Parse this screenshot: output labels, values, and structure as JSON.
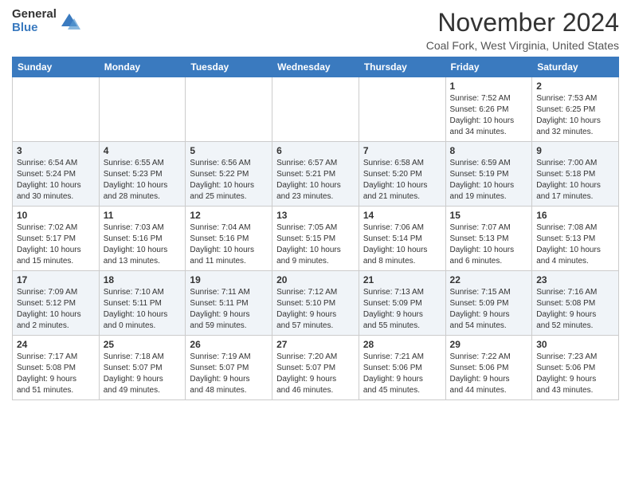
{
  "logo": {
    "general": "General",
    "blue": "Blue"
  },
  "header": {
    "month": "November 2024",
    "location": "Coal Fork, West Virginia, United States"
  },
  "weekdays": [
    "Sunday",
    "Monday",
    "Tuesday",
    "Wednesday",
    "Thursday",
    "Friday",
    "Saturday"
  ],
  "weeks": [
    [
      {
        "day": "",
        "info": ""
      },
      {
        "day": "",
        "info": ""
      },
      {
        "day": "",
        "info": ""
      },
      {
        "day": "",
        "info": ""
      },
      {
        "day": "",
        "info": ""
      },
      {
        "day": "1",
        "info": "Sunrise: 7:52 AM\nSunset: 6:26 PM\nDaylight: 10 hours\nand 34 minutes."
      },
      {
        "day": "2",
        "info": "Sunrise: 7:53 AM\nSunset: 6:25 PM\nDaylight: 10 hours\nand 32 minutes."
      }
    ],
    [
      {
        "day": "3",
        "info": "Sunrise: 6:54 AM\nSunset: 5:24 PM\nDaylight: 10 hours\nand 30 minutes."
      },
      {
        "day": "4",
        "info": "Sunrise: 6:55 AM\nSunset: 5:23 PM\nDaylight: 10 hours\nand 28 minutes."
      },
      {
        "day": "5",
        "info": "Sunrise: 6:56 AM\nSunset: 5:22 PM\nDaylight: 10 hours\nand 25 minutes."
      },
      {
        "day": "6",
        "info": "Sunrise: 6:57 AM\nSunset: 5:21 PM\nDaylight: 10 hours\nand 23 minutes."
      },
      {
        "day": "7",
        "info": "Sunrise: 6:58 AM\nSunset: 5:20 PM\nDaylight: 10 hours\nand 21 minutes."
      },
      {
        "day": "8",
        "info": "Sunrise: 6:59 AM\nSunset: 5:19 PM\nDaylight: 10 hours\nand 19 minutes."
      },
      {
        "day": "9",
        "info": "Sunrise: 7:00 AM\nSunset: 5:18 PM\nDaylight: 10 hours\nand 17 minutes."
      }
    ],
    [
      {
        "day": "10",
        "info": "Sunrise: 7:02 AM\nSunset: 5:17 PM\nDaylight: 10 hours\nand 15 minutes."
      },
      {
        "day": "11",
        "info": "Sunrise: 7:03 AM\nSunset: 5:16 PM\nDaylight: 10 hours\nand 13 minutes."
      },
      {
        "day": "12",
        "info": "Sunrise: 7:04 AM\nSunset: 5:16 PM\nDaylight: 10 hours\nand 11 minutes."
      },
      {
        "day": "13",
        "info": "Sunrise: 7:05 AM\nSunset: 5:15 PM\nDaylight: 10 hours\nand 9 minutes."
      },
      {
        "day": "14",
        "info": "Sunrise: 7:06 AM\nSunset: 5:14 PM\nDaylight: 10 hours\nand 8 minutes."
      },
      {
        "day": "15",
        "info": "Sunrise: 7:07 AM\nSunset: 5:13 PM\nDaylight: 10 hours\nand 6 minutes."
      },
      {
        "day": "16",
        "info": "Sunrise: 7:08 AM\nSunset: 5:13 PM\nDaylight: 10 hours\nand 4 minutes."
      }
    ],
    [
      {
        "day": "17",
        "info": "Sunrise: 7:09 AM\nSunset: 5:12 PM\nDaylight: 10 hours\nand 2 minutes."
      },
      {
        "day": "18",
        "info": "Sunrise: 7:10 AM\nSunset: 5:11 PM\nDaylight: 10 hours\nand 0 minutes."
      },
      {
        "day": "19",
        "info": "Sunrise: 7:11 AM\nSunset: 5:11 PM\nDaylight: 9 hours\nand 59 minutes."
      },
      {
        "day": "20",
        "info": "Sunrise: 7:12 AM\nSunset: 5:10 PM\nDaylight: 9 hours\nand 57 minutes."
      },
      {
        "day": "21",
        "info": "Sunrise: 7:13 AM\nSunset: 5:09 PM\nDaylight: 9 hours\nand 55 minutes."
      },
      {
        "day": "22",
        "info": "Sunrise: 7:15 AM\nSunset: 5:09 PM\nDaylight: 9 hours\nand 54 minutes."
      },
      {
        "day": "23",
        "info": "Sunrise: 7:16 AM\nSunset: 5:08 PM\nDaylight: 9 hours\nand 52 minutes."
      }
    ],
    [
      {
        "day": "24",
        "info": "Sunrise: 7:17 AM\nSunset: 5:08 PM\nDaylight: 9 hours\nand 51 minutes."
      },
      {
        "day": "25",
        "info": "Sunrise: 7:18 AM\nSunset: 5:07 PM\nDaylight: 9 hours\nand 49 minutes."
      },
      {
        "day": "26",
        "info": "Sunrise: 7:19 AM\nSunset: 5:07 PM\nDaylight: 9 hours\nand 48 minutes."
      },
      {
        "day": "27",
        "info": "Sunrise: 7:20 AM\nSunset: 5:07 PM\nDaylight: 9 hours\nand 46 minutes."
      },
      {
        "day": "28",
        "info": "Sunrise: 7:21 AM\nSunset: 5:06 PM\nDaylight: 9 hours\nand 45 minutes."
      },
      {
        "day": "29",
        "info": "Sunrise: 7:22 AM\nSunset: 5:06 PM\nDaylight: 9 hours\nand 44 minutes."
      },
      {
        "day": "30",
        "info": "Sunrise: 7:23 AM\nSunset: 5:06 PM\nDaylight: 9 hours\nand 43 minutes."
      }
    ]
  ]
}
